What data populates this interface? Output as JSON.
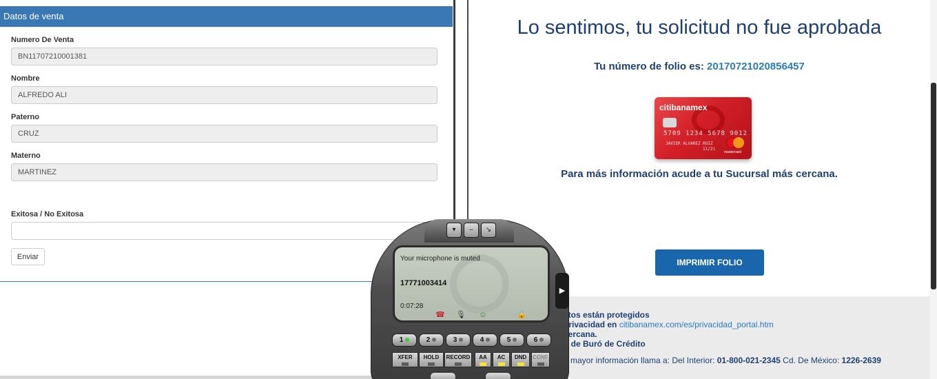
{
  "form": {
    "header": "Datos de venta",
    "fields": [
      {
        "label": "Numero De Venta",
        "value": "BN11707210001381"
      },
      {
        "label": "Nombre",
        "value": "ALFREDO ALI"
      },
      {
        "label": "Paterno",
        "value": "CRUZ"
      },
      {
        "label": "Materno",
        "value": "MARTINEZ"
      }
    ],
    "result_label": "Exitosa / No Exitosa",
    "result_value": "",
    "send_label": "Enviar"
  },
  "result": {
    "title": "Lo sentimos, tu solicitud no fue aprobada",
    "folio_label": "Tu número de folio es: ",
    "folio_number": "20170721020856457",
    "more_info": "Para más información acude a tu Sucursal más cercana.",
    "print_button": "IMPRIMIR FOLIO",
    "card": {
      "brand": "citibanamex",
      "number": "5709 1234 5678 9012",
      "holder": "JAVIER ALVAREZ RUIZ",
      "expiry": "11/21",
      "network": "mastercard"
    },
    "footer": {
      "line1": "atos están protegidos",
      "line2_prefix": "privacidad en ",
      "line2_link": "citibanamex.com/es/privacidad_portal.htm",
      "line3": "cercana.",
      "line4": "n de Buró de Crédito",
      "line5_prefix": "o mayor información llama a: Del Interior: ",
      "line5_phone1": "01-800-021-2345",
      "line5_mid": " Cd. De México: ",
      "line5_phone2": "1226-2639"
    }
  },
  "softphone": {
    "status": "Your microphone is muted",
    "number": "17771003414",
    "timer": "0:07:28",
    "line_keys": [
      "1",
      "2",
      "3",
      "4",
      "5",
      "6"
    ],
    "function_keys": [
      "XFER",
      "HOLD",
      "RECORD",
      "AA",
      "AC",
      "DND",
      "CONF"
    ],
    "colors": {
      "active_line": "#3bd13b",
      "led_on": "#f2e23b"
    }
  }
}
